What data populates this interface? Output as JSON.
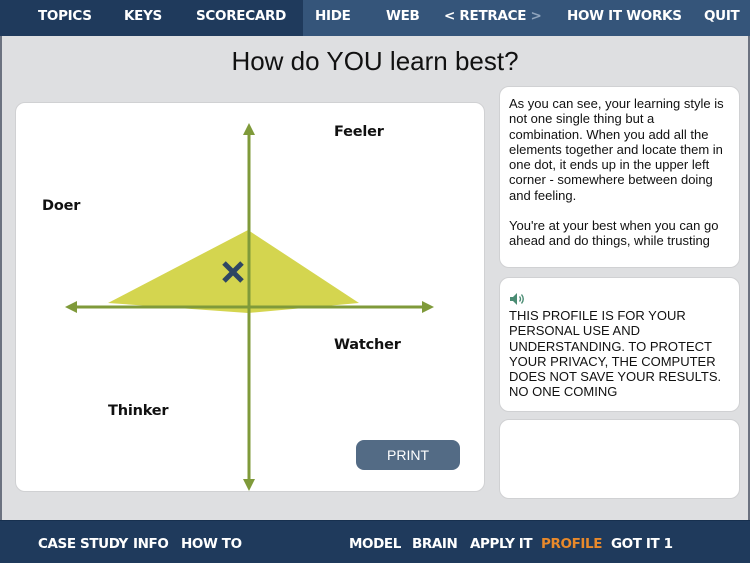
{
  "top_nav": {
    "items": [
      {
        "label": "TOPICS"
      },
      {
        "label": "KEYS"
      },
      {
        "label": "SCORECARD"
      },
      {
        "label": "HIDE"
      },
      {
        "label": "WEB"
      },
      {
        "label": "RETRACE",
        "prev_glyph": "<",
        "next_glyph": ">"
      },
      {
        "label": "HOW IT WORKS"
      },
      {
        "label": "QUIT"
      }
    ]
  },
  "page": {
    "title": "How do YOU learn best?"
  },
  "profile_chart": {
    "quadrant_labels": {
      "feeler": "Feeler",
      "doer": "Doer",
      "watcher": "Watcher",
      "thinker": "Thinker"
    },
    "marker_icon": "x-mark-icon",
    "colors": {
      "axis": "#7f9a3a",
      "area": "#d4d54f",
      "marker": "#2e4663"
    },
    "print_label": "PRINT"
  },
  "info_card": {
    "paragraphs": [
      "As you can see, your learning style is not one single thing but a combination. When you add all the elements together and locate them in one dot, it ends up in the upper left corner - somewhere between doing and feeling.",
      "You're at your best when you can go ahead and do things, while trusting"
    ]
  },
  "privacy_card": {
    "audio_icon": "speaker-icon",
    "text": "THIS PROFILE IS FOR YOUR PERSONAL USE AND UNDERSTANDING. TO PROTECT YOUR PRIVACY, THE COMPUTER DOES NOT SAVE YOUR RESULTS. NO ONE COMING"
  },
  "bottom_nav": {
    "items": [
      {
        "label": "CASE STUDY"
      },
      {
        "label": "INFO"
      },
      {
        "label": "HOW TO"
      },
      {
        "label": "MODEL"
      },
      {
        "label": "BRAIN"
      },
      {
        "label": "APPLY IT"
      },
      {
        "label": "PROFILE",
        "active": true
      },
      {
        "label": "GOT IT 1"
      }
    ],
    "active_color": "#e8892b"
  }
}
